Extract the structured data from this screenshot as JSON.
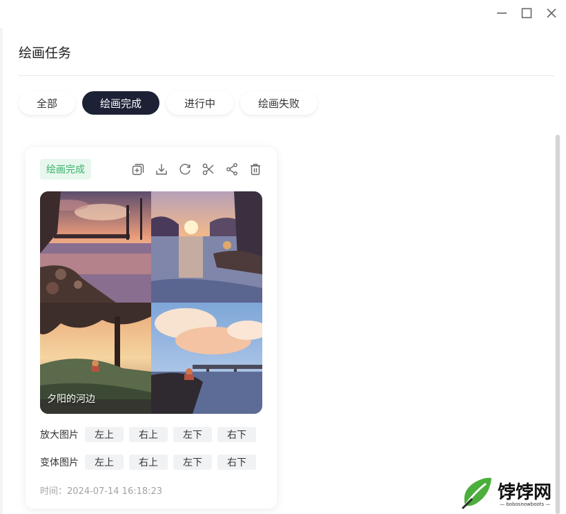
{
  "window": {
    "controls": [
      "minimize-icon",
      "maximize-icon",
      "close-icon"
    ]
  },
  "page": {
    "title": "绘画任务"
  },
  "tabs": [
    {
      "label": "全部",
      "active": false
    },
    {
      "label": "绘画完成",
      "active": true
    },
    {
      "label": "进行中",
      "active": false
    },
    {
      "label": "绘画失败",
      "active": false
    }
  ],
  "task": {
    "status": "绘画完成",
    "status_color": "#36b36a",
    "action_icons": [
      "copy-add-icon",
      "download-icon",
      "refresh-icon",
      "scissors-icon",
      "share-icon",
      "trash-icon"
    ],
    "image_caption": "夕阳的河边",
    "upscale": {
      "label": "放大图片",
      "options": [
        "左上",
        "右上",
        "左下",
        "右下"
      ]
    },
    "variation": {
      "label": "变体图片",
      "options": [
        "左上",
        "右上",
        "左下",
        "右下"
      ]
    },
    "time": "时间：2024-07-14 16:18:23"
  },
  "watermark": {
    "name": "饽饽网",
    "domain": "— bobosnowboots —"
  },
  "colors": {
    "accent": "#1c2136",
    "status_bg": "#e8f7ee"
  }
}
